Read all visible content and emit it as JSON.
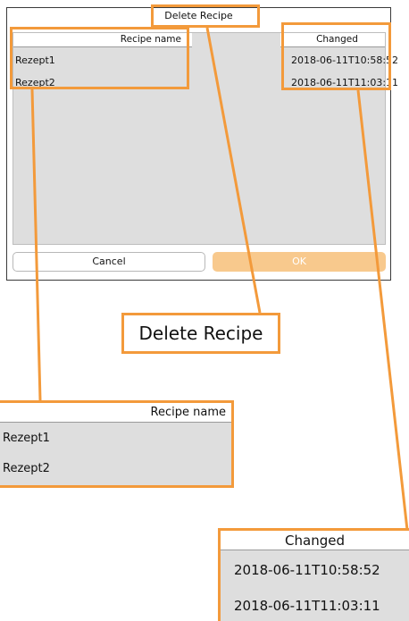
{
  "dialog": {
    "title": "Delete Recipe",
    "columns": {
      "name": "Recipe name",
      "changed": "Changed"
    },
    "rows": [
      {
        "name": "Rezept1",
        "changed": "2018-06-11T10:58:52"
      },
      {
        "name": "Rezept2",
        "changed": "2018-06-11T11:03:11"
      }
    ],
    "buttons": {
      "cancel": "Cancel",
      "ok": "OK"
    }
  },
  "callouts": {
    "title": "Delete Recipe",
    "recipe_name": {
      "header": "Recipe name",
      "rows": [
        "Rezept1",
        "Rezept2"
      ]
    },
    "changed": {
      "header": "Changed",
      "rows": [
        "2018-06-11T10:58:52",
        "2018-06-11T11:03:11"
      ]
    }
  },
  "colors": {
    "highlight": "#f39a3b",
    "ok_button": "#f8c98d",
    "table_bg": "#dedede"
  }
}
